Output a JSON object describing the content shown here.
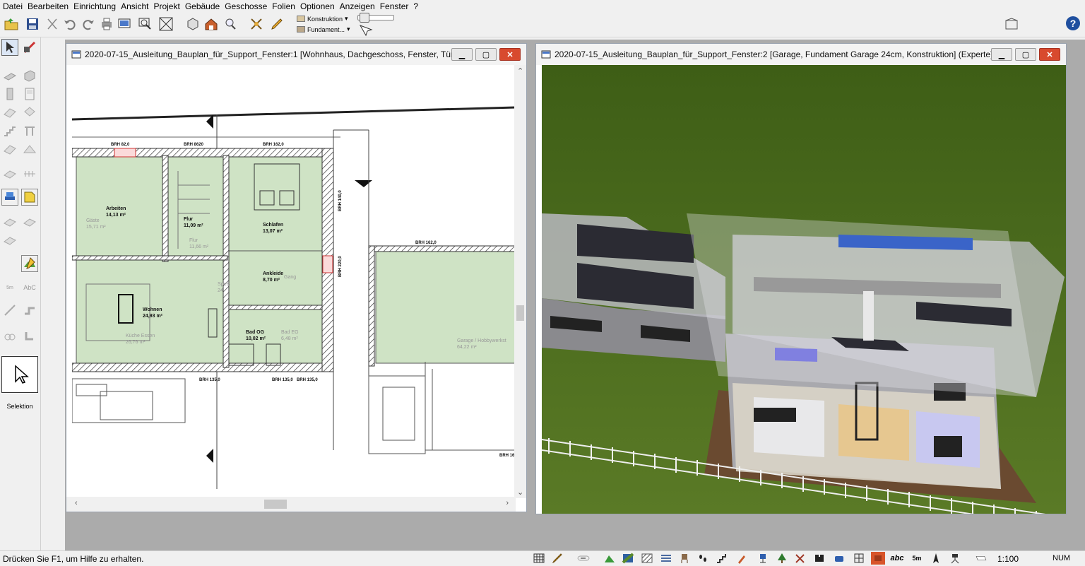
{
  "menu": [
    "Datei",
    "Bearbeiten",
    "Einrichtung",
    "Ansicht",
    "Projekt",
    "Gebäude",
    "Geschosse",
    "Folien",
    "Optionen",
    "Anzeigen",
    "Fenster",
    "?"
  ],
  "toolbar": {
    "layer_dropdown": "Konstruktion",
    "material_dropdown": "Fundament..."
  },
  "palette": {
    "selection_label": "Selektion",
    "text_tool_label": "AbC",
    "measure_label": "5m"
  },
  "windows": {
    "plan_title": "2020-07-15_Ausleitung_Bauplan_für_Support_Fenster:1 [Wohnhaus, Dachgeschoss, Fenster, Türen,...",
    "render_title": "2020-07-15_Ausleitung_Bauplan_für_Support_Fenster:2 [Garage, Fundament Garage 24cm, Konstruktion] (Experte)"
  },
  "plan": {
    "rooms": [
      {
        "name": "Arbeiten",
        "area": "14,13 m²"
      },
      {
        "name": "Flur",
        "area": "11,09 m²"
      },
      {
        "name": "Schlafen",
        "area": "13,07 m²"
      },
      {
        "name": "Ankleide",
        "area": "8,70 m²"
      },
      {
        "name": "Wohnen",
        "area": "24,93 m²"
      },
      {
        "name": "Bad OG",
        "area": "10,02 m²"
      }
    ],
    "ghost_labels": [
      {
        "name": "Gäste",
        "area": "15,71 m²"
      },
      {
        "name": "Flur",
        "area": "11,66 m²"
      },
      {
        "name": "Küche Essen",
        "area": "26,76 m²"
      },
      {
        "name": "Bad EG",
        "area": "6,48 m²"
      },
      {
        "name": "Garage / Hobbywerkst",
        "area": "64,22 m²"
      },
      {
        "name": "Speis",
        "area": "24"
      },
      {
        "name": "Gang",
        "area": ""
      }
    ],
    "brh_labels": [
      "BRH 82,0",
      "BRH 8620",
      "BRH 162,0",
      "BRH 140,0",
      "BRH 220,0",
      "BRH 162,0",
      "BRH 135,0",
      "BRH 135,0",
      "BRH 135,0",
      "BRH 16"
    ]
  },
  "status": {
    "help": "Drücken Sie F1, um Hilfe zu erhalten.",
    "scale": "1:100",
    "num": "NUM",
    "abc": "abc",
    "measure": "5m"
  },
  "colors": {
    "room_fill": "#cfe3c5",
    "wall_hatch": "#444444",
    "close_button": "#d84a2e",
    "mdi_background": "#ababab",
    "grass": "#4a6a1c"
  }
}
